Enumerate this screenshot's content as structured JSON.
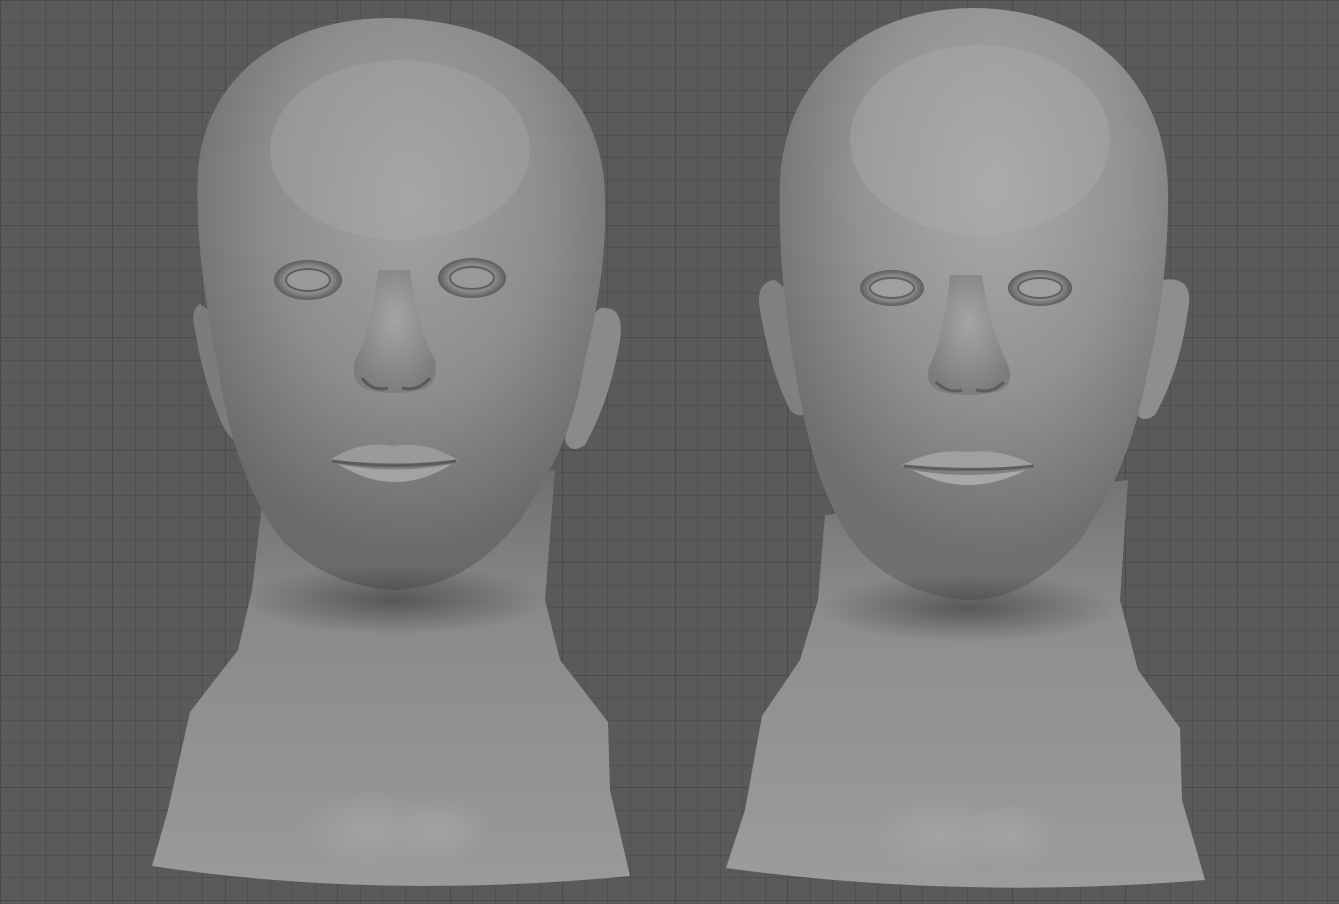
{
  "viewport": {
    "background_color": "#5a5a5a",
    "grid_line_color": "#474747",
    "grid_major_line_color": "#3c3c3c",
    "grid_visible": true
  },
  "models": [
    {
      "name": "head-model-left",
      "shading": "matte-gray",
      "base_color": "#8f8f8f"
    },
    {
      "name": "head-model-right",
      "shading": "matte-gray",
      "base_color": "#959595"
    }
  ]
}
